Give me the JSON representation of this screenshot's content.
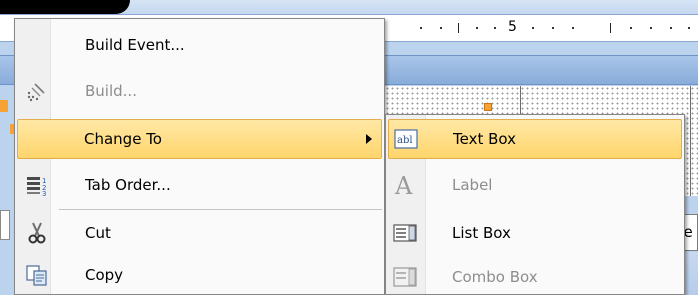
{
  "ruler": {
    "mark_label": "5"
  },
  "main_menu": {
    "items": [
      {
        "label": "Build Event...",
        "icon": "none",
        "enabled": true
      },
      {
        "label": "Build...",
        "icon": "wand-icon",
        "enabled": false
      },
      {
        "label": "Change To",
        "icon": "none",
        "enabled": true,
        "highlighted": true,
        "submenu": true
      },
      {
        "label": "Tab Order...",
        "icon": "tab-order-icon",
        "enabled": true
      },
      {
        "label": "Cut",
        "icon": "scissors-icon",
        "enabled": true
      },
      {
        "label": "Copy",
        "icon": "copy-icon",
        "enabled": true
      }
    ]
  },
  "submenu": {
    "items": [
      {
        "label": "Text Box",
        "icon": "text-box-icon",
        "enabled": true,
        "highlighted": true
      },
      {
        "label": "Label",
        "icon": "label-icon",
        "enabled": false
      },
      {
        "label": "List Box",
        "icon": "list-box-icon",
        "enabled": true
      },
      {
        "label": "Combo Box",
        "icon": "combo-box-icon",
        "enabled": false
      }
    ]
  },
  "background": {
    "control_text_fragment": "be"
  },
  "colors": {
    "highlight_top": "#ffe8a6",
    "highlight_bottom": "#ffd56b",
    "highlight_border": "#e3ad4c",
    "section_bar": "#a9c5ea",
    "disabled_text": "#8d8d8d",
    "handle": "#f6a234"
  }
}
